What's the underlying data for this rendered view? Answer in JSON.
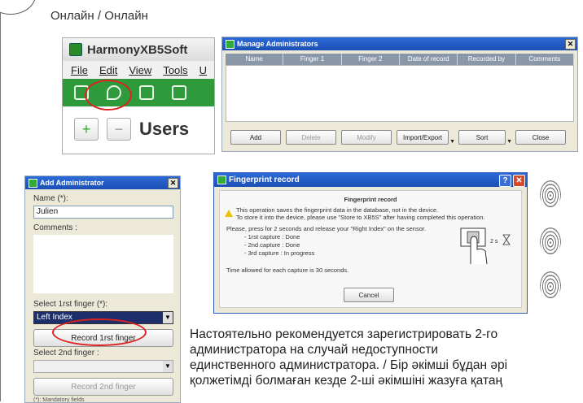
{
  "section": {
    "title": "Онлайн / Онлайн"
  },
  "harmony": {
    "app_title": "HarmonyXB5Soft",
    "menu": [
      "File",
      "Edit",
      "View",
      "Tools",
      "U"
    ],
    "add_symbol": "+",
    "remove_symbol": "−",
    "users_label": "Users"
  },
  "manage": {
    "title": "Manage Administrators",
    "columns": [
      "Name",
      "Finger 1",
      "Finger 2",
      "Date of record",
      "Recorded by",
      "Comments"
    ],
    "buttons": {
      "add": "Add",
      "delete": "Delete",
      "modify": "Modify",
      "import_export": "Import/Export",
      "sort": "Sort",
      "close": "Close"
    }
  },
  "add_admin": {
    "title": "Add Administrator",
    "name_label": "Name (*):",
    "name_value": "Julien",
    "comments_label": "Comments :",
    "first_finger_label": "Select 1rst finger (*):",
    "first_finger_value": "Left Index",
    "record_first": "Record 1rst finger",
    "second_finger_label": "Select 2nd finger :",
    "record_second": "Record 2nd finger",
    "footnote": "(*): Mandatory fields"
  },
  "fingerprint": {
    "title": "Fingerprint record",
    "heading": "Fingerprint record",
    "warn1": "This operation saves the fingerprint data in the database, not in the device.",
    "warn2": "To store it into the device, please use \"Store to XB5S\" after having completed this operation.",
    "instr": "Please, press for 2 seconds and release your \"Right Index\" on the sensor.",
    "cap1": "- 1rst capture : Done",
    "cap2": "- 2nd capture : Done",
    "cap3": "- 3rd capture : In progress",
    "time": "Time allowed for each capture is 30 seconds.",
    "cancel": "Cancel",
    "sensor_label": "2 s"
  },
  "paragraph": {
    "l1": "Настоятельно рекомендуется зарегистрировать 2-го",
    "l2": "администратора на случай недоступности",
    "l3": "единственного администратора. / Бір әкімші бұдан әрі",
    "l4": "қолжетімді болмаған кезде 2-ші әкімшіні жазуға қатаң"
  }
}
